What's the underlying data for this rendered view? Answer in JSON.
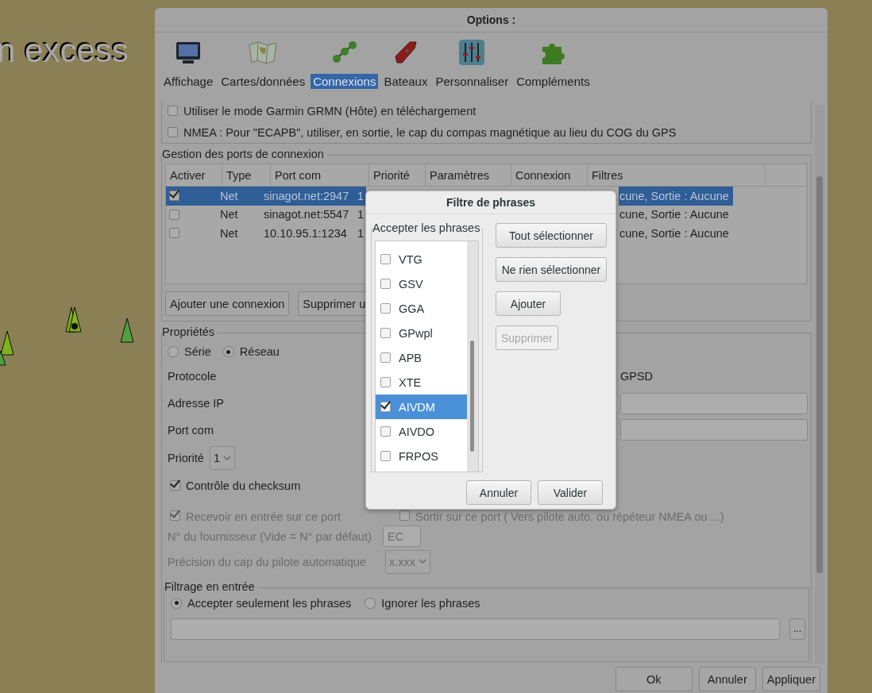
{
  "map": {
    "label": "n excess"
  },
  "window": {
    "title": "Options :"
  },
  "tabs": [
    {
      "label": "Affichage",
      "selected": false
    },
    {
      "label": "Cartes/données",
      "selected": false
    },
    {
      "label": "Connexions",
      "selected": true
    },
    {
      "label": "Bateaux",
      "selected": false
    },
    {
      "label": "Personnaliser",
      "selected": false
    },
    {
      "label": "Compléments",
      "selected": false
    }
  ],
  "options": [
    {
      "label": "Utiliser le mode Garmin GRMN (Hôte) en téléchargement",
      "checked": false
    },
    {
      "label": "NMEA : Pour \"ECAPB\", utiliser, en sortie, le cap du compas magnétique  au lieu du COG du GPS",
      "checked": false
    }
  ],
  "ports": {
    "legend": "Gestion des ports de connexion",
    "columns": [
      "Activer",
      "Type",
      "Port com",
      "Priorité",
      "Paramètres",
      "Connexion",
      "Filtres"
    ],
    "rows": [
      {
        "enabled": true,
        "type": "Net",
        "port": "sinagot.net:2947",
        "priority": "1",
        "filters": "cune, Sortie : Aucune",
        "selected": true
      },
      {
        "enabled": false,
        "type": "Net",
        "port": "sinagot.net:5547",
        "priority": "1",
        "filters": "cune, Sortie : Aucune",
        "selected": false
      },
      {
        "enabled": false,
        "type": "Net",
        "port": "10.10.95.1:1234",
        "priority": "1",
        "filters": "cune, Sortie : Aucune",
        "selected": false
      }
    ],
    "buttons": [
      "Ajouter une connexion",
      "Supprimer u"
    ]
  },
  "properties": {
    "legend": "Propriétés",
    "interface": [
      {
        "label": "Série",
        "selected": false
      },
      {
        "label": "Réseau",
        "selected": true
      }
    ],
    "protocol_label": "Protocole",
    "protocol_value": "GPSD",
    "ip_label": "Adresse IP",
    "port_label": "Port com",
    "priority_label": "Priorité",
    "priority_value": "1",
    "checksum": {
      "label": "Contrôle du checksum",
      "checked": true
    },
    "receive": {
      "label": "Recevoir en entrée sur ce port",
      "checked": true,
      "disabled": true
    },
    "send": {
      "label": "Sortir sur ce port ( Vers pilote auto. ou répéteur NMEA ou ...)",
      "checked": false,
      "disabled": true
    },
    "talker_label": "N° du fournisseur (Vide = N° par défaut)",
    "talker_value": "EC",
    "precision_label": "Précision du cap du pilote automatique",
    "precision_value": "x.xxx"
  },
  "input_filter": {
    "legend": "Filtrage en entrée",
    "modes": [
      {
        "label": "Accepter seulement les phrases",
        "selected": true
      },
      {
        "label": "Ignorer les phrases",
        "selected": false
      }
    ],
    "browse_label": "..."
  },
  "footer_buttons": [
    "Ok",
    "Annuler",
    "Appliquer"
  ],
  "filter_dialog": {
    "title": "Filtre de phrases",
    "group": "Accepter les phrases",
    "sentences": [
      {
        "label": "VTG",
        "checked": false,
        "selected": false
      },
      {
        "label": "GSV",
        "checked": false,
        "selected": false
      },
      {
        "label": "GGA",
        "checked": false,
        "selected": false
      },
      {
        "label": "GPwpl",
        "checked": false,
        "selected": false
      },
      {
        "label": "APB",
        "checked": false,
        "selected": false
      },
      {
        "label": "XTE",
        "checked": false,
        "selected": false
      },
      {
        "label": "AIVDM",
        "checked": true,
        "selected": true
      },
      {
        "label": "AIVDO",
        "checked": false,
        "selected": false
      },
      {
        "label": "FRPOS",
        "checked": false,
        "selected": false
      }
    ],
    "side_buttons": [
      {
        "label": "Tout sélectionner",
        "disabled": false
      },
      {
        "label": "Ne rien sélectionner",
        "disabled": false
      },
      {
        "label": "Ajouter",
        "disabled": false
      },
      {
        "label": "Supprimer",
        "disabled": true
      }
    ],
    "buttons": [
      "Annuler",
      "Valider"
    ]
  }
}
